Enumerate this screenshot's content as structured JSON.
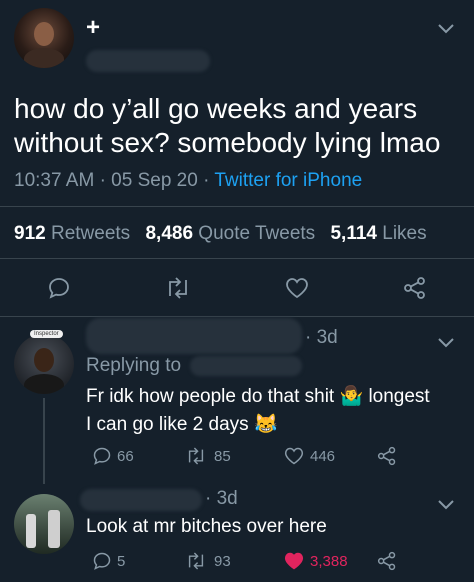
{
  "main_tweet": {
    "follow_badge": "+",
    "text": "how do y’all go weeks and years without sex? somebody lying lmao",
    "time": "10:37 AM",
    "sep1": "·",
    "date": "05 Sep 20",
    "sep2": "·",
    "source": "Twitter for iPhone",
    "stats": {
      "retweets_count": "912",
      "retweets_label": "Retweets",
      "quotes_count": "8,486",
      "quotes_label": "Quote Tweets",
      "likes_count": "5,114",
      "likes_label": "Likes"
    }
  },
  "reply1": {
    "badge": "Inspector",
    "time": "3d",
    "replying_to": "Replying to",
    "text_line1": "Fr idk how people do that shit",
    "emoji1": "🤷‍♂️",
    "text_line1b": "longest",
    "text_line2": "I can go like 2 days",
    "emoji2": "😹",
    "replies": "66",
    "retweets": "85",
    "likes": "446"
  },
  "reply2": {
    "time": "3d",
    "text": "Look at mr bitches over here",
    "replies": "5",
    "retweets": "93",
    "likes": "3,388",
    "like_color": "#e0245e"
  },
  "colors": {
    "background": "#15202b",
    "muted": "#8899a6",
    "link": "#1da1f2"
  }
}
